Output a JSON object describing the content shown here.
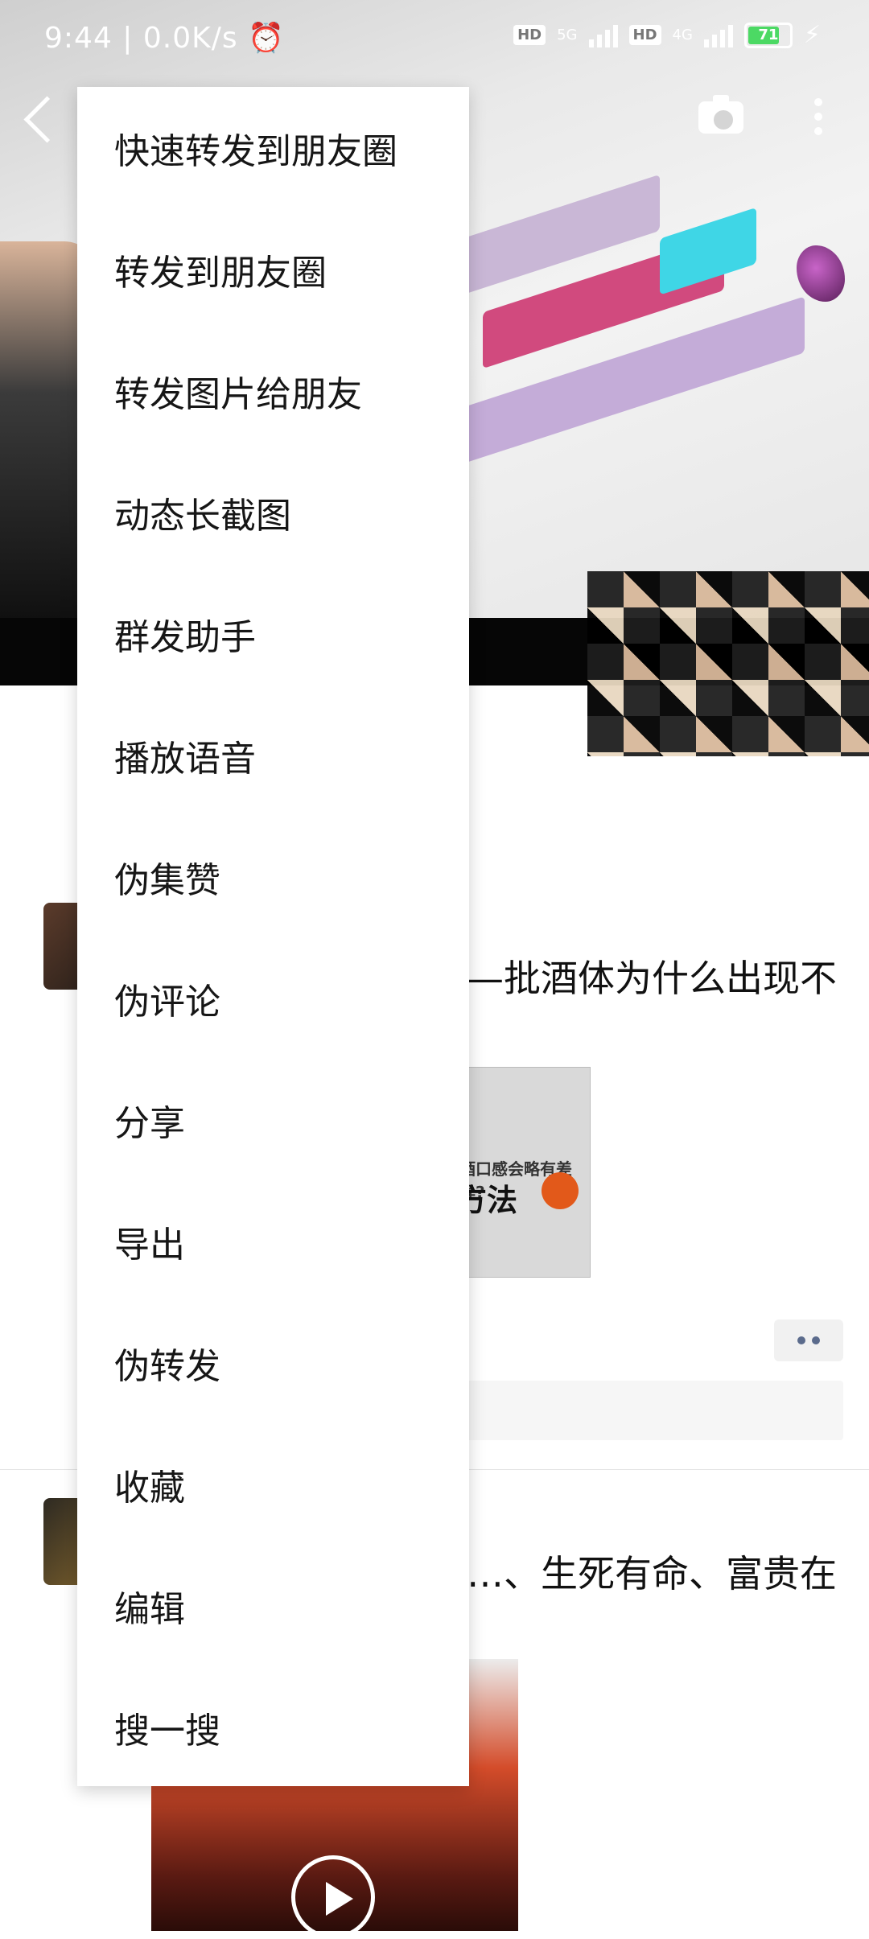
{
  "status_bar": {
    "time": "9:44",
    "network_speed": "0.0K/s",
    "hd1": "HD",
    "net1": "5G",
    "hd2": "HD",
    "net2": "4G",
    "battery_level": "71"
  },
  "colors": {
    "battery_fill": "#4cd964",
    "menu_bg": "#ffffff",
    "menu_text": "#161616"
  },
  "feed": {
    "post1_text": "—批酒体为什么出现不",
    "post2_text": "…、生死有命、富贵在",
    "thumb_heading": "酒口感会略有差异?",
    "thumb_title": "方法"
  },
  "menu": {
    "items": [
      {
        "label": "快速转发到朋友圈"
      },
      {
        "label": "转发到朋友圈"
      },
      {
        "label": "转发图片给朋友"
      },
      {
        "label": "动态长截图"
      },
      {
        "label": "群发助手"
      },
      {
        "label": "播放语音"
      },
      {
        "label": "伪集赞"
      },
      {
        "label": "伪评论"
      },
      {
        "label": "分享"
      },
      {
        "label": "导出"
      },
      {
        "label": "伪转发"
      },
      {
        "label": "收藏"
      },
      {
        "label": "编辑"
      },
      {
        "label": "搜一搜"
      }
    ]
  }
}
